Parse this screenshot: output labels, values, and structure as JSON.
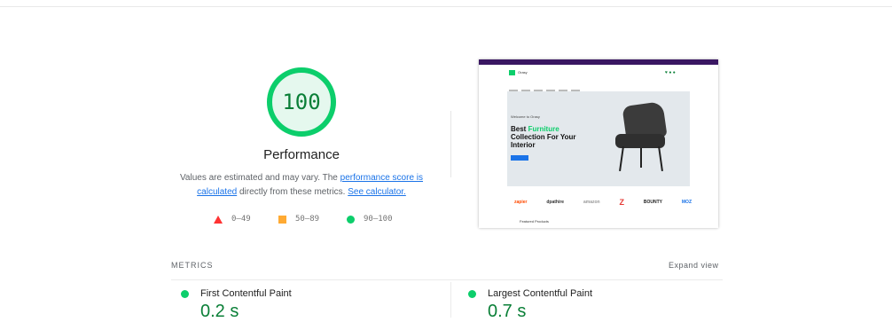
{
  "score": {
    "value": "100",
    "title": "Performance"
  },
  "note": {
    "prefix": "Values are estimated and may vary. The ",
    "link1": "performance score is calculated",
    "middle": " directly from these metrics. ",
    "link2": "See calculator."
  },
  "legend": [
    {
      "icon": "fail-triangle-icon",
      "label": "0–49"
    },
    {
      "icon": "average-square-icon",
      "label": "50–89"
    },
    {
      "icon": "pass-circle-icon",
      "label": "90–100"
    }
  ],
  "thumbnail": {
    "site_name": "Orasy",
    "welcome": "Welcome to Orasy",
    "headline_1": "Best ",
    "headline_accent": "Furniture",
    "headline_2": "Collection For Your",
    "headline_3": "Interior",
    "brands": [
      "zapier",
      "dpathire",
      "amazon",
      "Z",
      "BOUNTY",
      "MOZ"
    ],
    "featured": "Featured Products"
  },
  "metrics": {
    "heading": "METRICS",
    "expand": "Expand view",
    "items": [
      {
        "label": "First Contentful Paint",
        "value": "0.2 s"
      },
      {
        "label": "Largest Contentful Paint",
        "value": "0.7 s"
      }
    ]
  },
  "colors": {
    "pass": "#0cce6b",
    "pass_text": "#0a7f37",
    "average": "#ffaa33",
    "fail": "#ff3333",
    "link": "#1a73e8"
  }
}
